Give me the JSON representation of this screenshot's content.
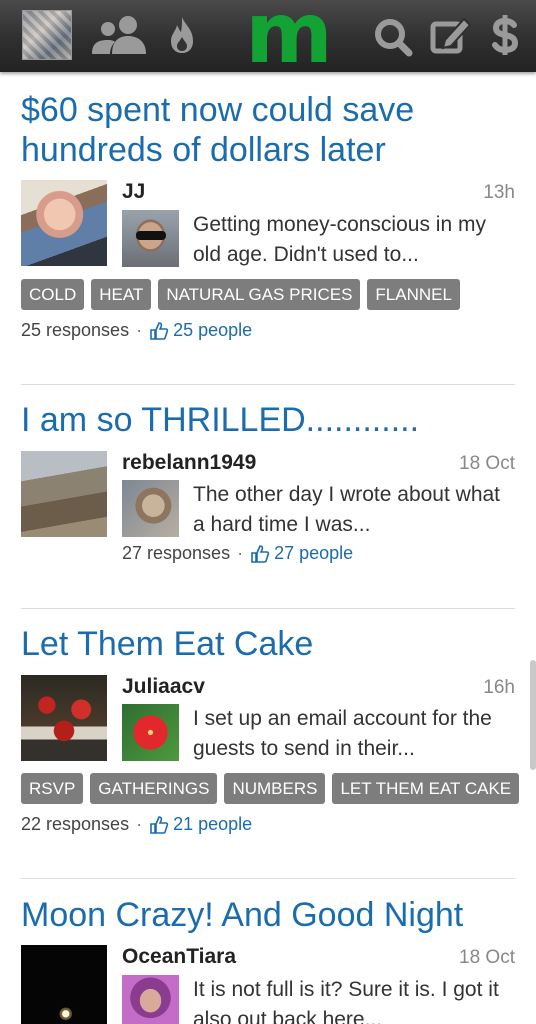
{
  "header": {
    "logo": "m",
    "icons": [
      "profile-thumbnail",
      "people-icon",
      "flame-icon",
      "search-icon",
      "compose-icon",
      "dollar-icon"
    ],
    "logo_color": "#12a334"
  },
  "feed": [
    {
      "title": "$60 spent now could save hundreds of dollars later",
      "author": "JJ",
      "time": "13h",
      "excerpt": "Getting money-conscious in my old age. Didn't used to...",
      "tags": [
        "COLD",
        "HEAT",
        "NATURAL GAS PRICES",
        "FLANNEL"
      ],
      "responses": "25 responses",
      "people": "25 people"
    },
    {
      "title": "I am so THRILLED............",
      "author": "rebelann1949",
      "time": "18 Oct",
      "excerpt": "The other day I wrote about what a hard time I was...",
      "tags": [],
      "responses": "27 responses",
      "people": "27 people"
    },
    {
      "title": "Let Them Eat Cake",
      "author": "Juliaacv",
      "time": "16h",
      "excerpt": "I set up an email account for the guests to send in their...",
      "tags": [
        "RSVP",
        "GATHERINGS",
        "NUMBERS",
        "LET THEM EAT CAKE"
      ],
      "responses": "22 responses",
      "people": "21 people"
    },
    {
      "title": "Moon Crazy! And Good Night",
      "author": "OceanTiara",
      "time": "18 Oct",
      "excerpt": "It is not full is it? Sure it is. I got it also out back here..."
    }
  ],
  "colors": {
    "title": "#1b6cae",
    "tag_background": "#7d7d7d",
    "link": "#1b6cae"
  }
}
